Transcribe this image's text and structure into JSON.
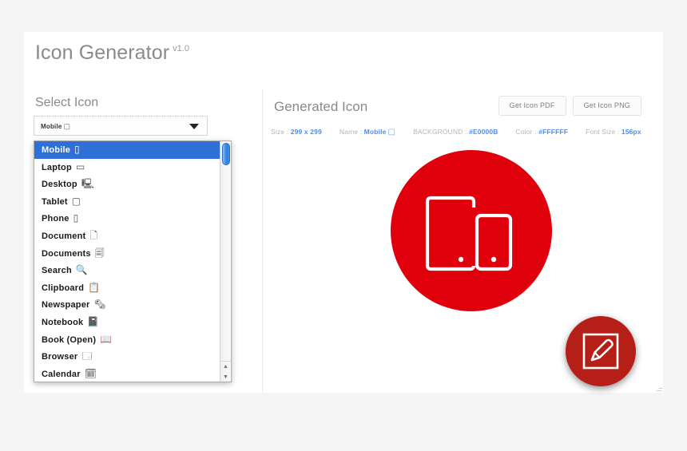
{
  "app": {
    "title": "Icon Generator",
    "version": "v1.0"
  },
  "left_panel": {
    "label": "Select Icon",
    "select": {
      "value": "Mobile",
      "value_glyph": "▢",
      "caret_icon": "chevron-down-icon"
    },
    "dropdown": {
      "selected_index": 0,
      "items": [
        {
          "label": "Mobile",
          "glyph": "▯"
        },
        {
          "label": "Laptop",
          "glyph": "▭"
        },
        {
          "label": "Desktop",
          "glyph": "🖳"
        },
        {
          "label": "Tablet",
          "glyph": "▢"
        },
        {
          "label": "Phone",
          "glyph": "▯"
        },
        {
          "label": "Document",
          "glyph": "🗋"
        },
        {
          "label": "Documents",
          "glyph": "🗐"
        },
        {
          "label": "Search",
          "glyph": "🔍"
        },
        {
          "label": "Clipboard",
          "glyph": "📋"
        },
        {
          "label": "Newspaper",
          "glyph": "🗞"
        },
        {
          "label": "Notebook",
          "glyph": "📓"
        },
        {
          "label": "Book (Open)",
          "glyph": "📖"
        },
        {
          "label": "Browser",
          "glyph": "🗔"
        },
        {
          "label": "Calendar",
          "glyph": "🗓"
        }
      ]
    }
  },
  "right_panel": {
    "title": "Generated Icon",
    "buttons": {
      "pdf": "Get Icon PDF",
      "png": "Get Icon PNG"
    },
    "meta": {
      "size_label": "Size :",
      "size_value": "299 x 299",
      "name_label": "Name :",
      "name_value": "Mobile",
      "name_glyph": "▢",
      "background_label": "BACKGROUND :",
      "background_value": "#E0000B",
      "color_label": "Color :",
      "color_value": "#FFFFFF",
      "font_size_label": "Font Size :",
      "font_size_value": "156px"
    },
    "preview": {
      "circle_color": "#E0000B",
      "glyph_color": "#FFFFFF",
      "icon_name": "mobile-devices-icon"
    },
    "fab": {
      "icon_name": "pencil-edit-icon",
      "color": "#B51F18"
    }
  }
}
